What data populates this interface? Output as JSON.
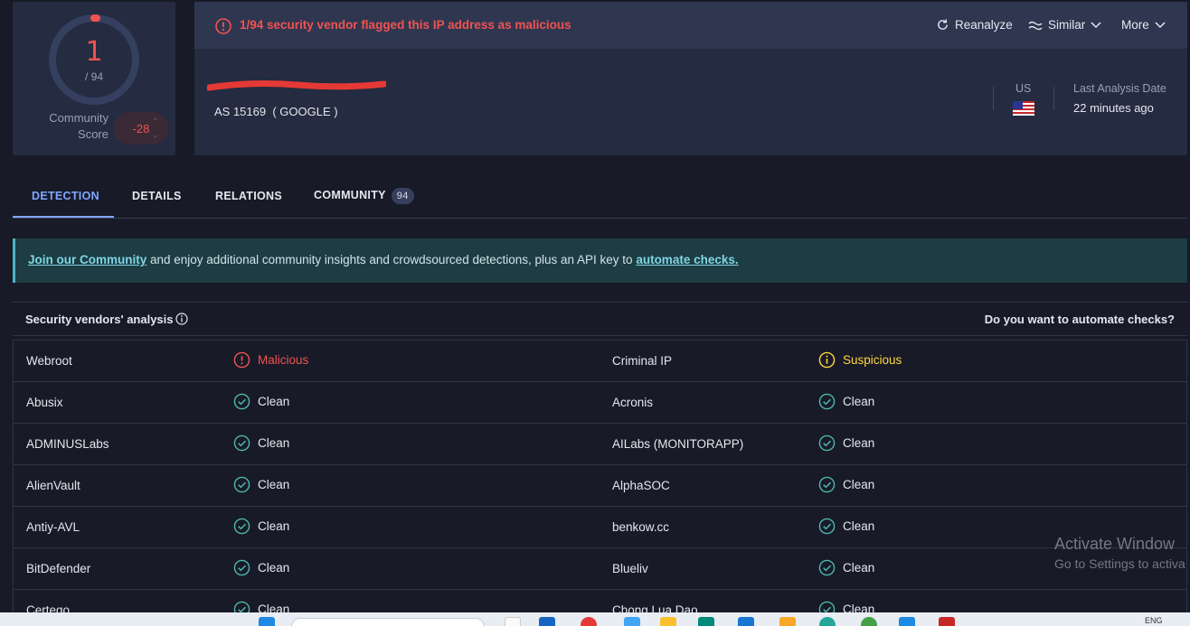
{
  "score": {
    "detections": "1",
    "total": "/ 94",
    "fraction_flagged": 0.0106
  },
  "community": {
    "label_line1": "Community",
    "label_line2": "Score",
    "value": "-28"
  },
  "alert": {
    "text": "1/94 security vendor flagged this IP address as malicious"
  },
  "actions": {
    "reanalyze": "Reanalyze",
    "similar": "Similar",
    "more": "More"
  },
  "ip": {
    "as_number": "AS 15169",
    "as_owner": "( GOOGLE )"
  },
  "location": {
    "country": "US",
    "last_analysis_label": "Last Analysis Date",
    "last_analysis_value": "22 minutes ago"
  },
  "tabs": [
    {
      "label": "DETECTION",
      "active": true
    },
    {
      "label": "DETAILS"
    },
    {
      "label": "RELATIONS"
    },
    {
      "label": "COMMUNITY",
      "badge": "94"
    }
  ],
  "banner": {
    "link1": "Join our Community",
    "middle": " and enjoy additional community insights and crowdsourced detections, plus an API key to ",
    "link2": "automate checks."
  },
  "vendors": {
    "title": "Security vendors' analysis",
    "cta": "Do you want to automate checks?",
    "rows": [
      {
        "left_name": "Webroot",
        "left_result": "Malicious",
        "left_type": "malicious",
        "right_name": "Criminal IP",
        "right_result": "Suspicious",
        "right_type": "suspicious"
      },
      {
        "left_name": "Abusix",
        "left_result": "Clean",
        "left_type": "clean",
        "right_name": "Acronis",
        "right_result": "Clean",
        "right_type": "clean"
      },
      {
        "left_name": "ADMINUSLabs",
        "left_result": "Clean",
        "left_type": "clean",
        "right_name": "AILabs (MONITORAPP)",
        "right_result": "Clean",
        "right_type": "clean"
      },
      {
        "left_name": "AlienVault",
        "left_result": "Clean",
        "left_type": "clean",
        "right_name": "AlphaSOC",
        "right_result": "Clean",
        "right_type": "clean"
      },
      {
        "left_name": "Antiy-AVL",
        "left_result": "Clean",
        "left_type": "clean",
        "right_name": "benkow.cc",
        "right_result": "Clean",
        "right_type": "clean"
      },
      {
        "left_name": "BitDefender",
        "left_result": "Clean",
        "left_type": "clean",
        "right_name": "Blueliv",
        "right_result": "Clean",
        "right_type": "clean"
      },
      {
        "left_name": "Certego",
        "left_result": "Clean",
        "left_type": "clean",
        "right_name": "Chong Lua Dao",
        "right_result": "Clean",
        "right_type": "clean"
      }
    ]
  },
  "watermark": {
    "line1": "Activate Window",
    "line2": "Go to Settings to activa"
  },
  "taskbar": {
    "lang": "ENG"
  },
  "colors": {
    "malicious": "#ef5350",
    "suspicious": "#ffd740",
    "clean": "#4db6ac",
    "accent": "#7fa8ff"
  }
}
